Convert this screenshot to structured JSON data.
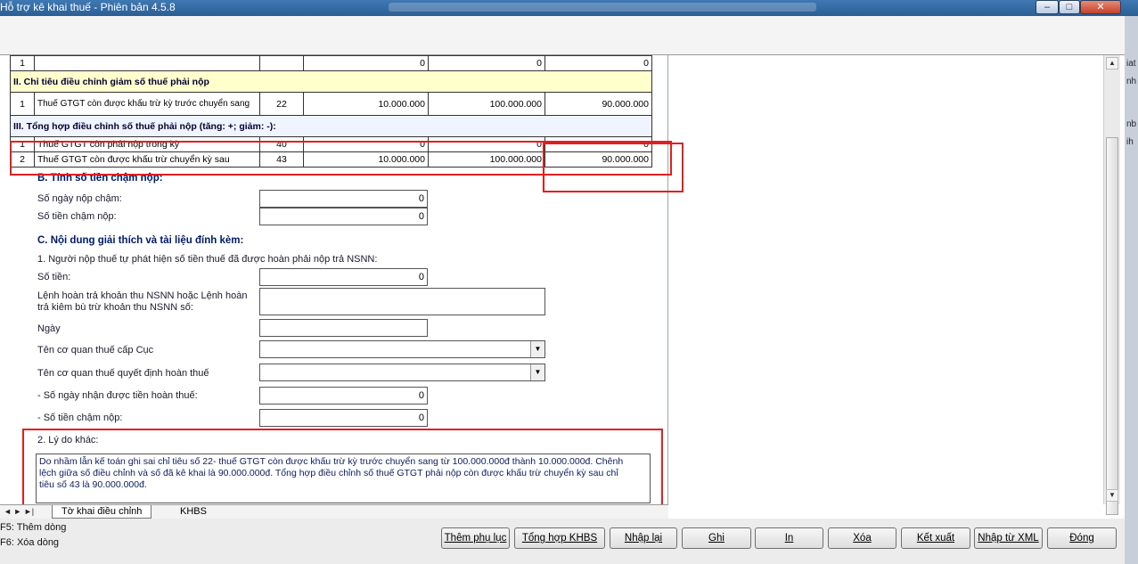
{
  "window": {
    "title": "Hỗ trợ kê khai thuế -  Phiên bản 4.5.8",
    "controls": {
      "minimize": "–",
      "maximize": "□",
      "close": "✕"
    }
  },
  "right_strip": [
    "iat",
    "nh",
    "nb",
    "ih"
  ],
  "table": {
    "top_row": {
      "stt": "1",
      "code": "",
      "v1": "0",
      "v2": "0",
      "v3": "0"
    },
    "section2_title": "II. Chỉ tiêu điều chỉnh giảm số thuế phải nộp",
    "section2_row": {
      "stt": "1",
      "name": "Thuế GTGT còn được khấu trừ kỳ trước chuyển sang",
      "code": "22",
      "v1": "10.000.000",
      "v2": "100.000.000",
      "v3": "90.000.000"
    },
    "section3_title": "III. Tổng hợp điều chỉnh số thuế phải nộp (tăng: +; giảm: -):",
    "section3_rows": [
      {
        "stt": "1",
        "name": "Thuế GTGT còn phải nộp trong kỳ",
        "code": "40",
        "v1": "0",
        "v2": "0",
        "v3": "0"
      },
      {
        "stt": "2",
        "name": "Thuế GTGT còn được khấu trừ chuyển kỳ sau",
        "code": "43",
        "v1": "10.000.000",
        "v2": "100.000.000",
        "v3": "90.000.000"
      }
    ]
  },
  "section_b": {
    "title": "B. Tính số tiền chậm nộp:",
    "late_days_label": "Số ngày nộp chậm:",
    "late_days_value": "0",
    "late_amount_label": "Số tiền chậm nộp:",
    "late_amount_value": "0"
  },
  "section_c": {
    "title": "C. Nội dung giải thích và tài liệu đính kèm:",
    "item1": "1. Người nộp thuế tự phát hiện số tiền thuế đã được hoàn phải nộp trả NSNN:",
    "amount_label": "Số tiền:",
    "amount_value": "0",
    "order_label_1": "Lệnh hoàn trả khoản thu NSNN hoặc Lệnh hoàn",
    "order_label_2": "trả kiêm bù trừ khoản thu NSNN số:",
    "date_label": "Ngày",
    "dept_label": "Tên cơ quan thuế cấp Cục",
    "decision_label": "Tên cơ quan thuế quyết định hoàn thuế",
    "refund_days_label": "- Số ngày nhận được tiền hoàn thuế:",
    "refund_days_value": "0",
    "late_amount_label": "- Số tiền chậm nộp:",
    "late_amount_value": "0",
    "item2": "2. Lý do khác:",
    "reason_line1": "Do nhầm lẫn kế toán ghi sai chỉ tiêu số 22- thuế GTGT còn được khấu trừ kỳ trước chuyển sang từ 100.000.000đ thành 10.000.000đ. Chênh",
    "reason_line2": "lệch giữa số điều chỉnh và số đã kê khai là 90.000.000đ. Tổng hợp điều chỉnh số thuế GTGT phải nộp còn được khấu trừ chuyển kỳ sau chỉ",
    "reason_line3": "tiêu số 43 là 90.000.000đ."
  },
  "tabs": {
    "nav": "◄ ► ►|",
    "active": "Tờ khai điều chỉnh",
    "other": "KHBS"
  },
  "hints": {
    "f5": "F5: Thêm dòng",
    "f6": "F6: Xóa dòng"
  },
  "buttons": {
    "them_phu_luc": "Thêm phụ lục",
    "tong_hop": "Tổng hợp KHBS",
    "nhap_lai": "Nhập lại",
    "ghi": "Ghi",
    "in": "In",
    "xoa": "Xóa",
    "ket_xuat": "Kết xuất",
    "nhap_xml": "Nhập từ XML",
    "dong": "Đóng"
  },
  "colors": {
    "highlight": "#e02020",
    "section_bg": "#ffffcc",
    "header_text": "#001a66"
  }
}
